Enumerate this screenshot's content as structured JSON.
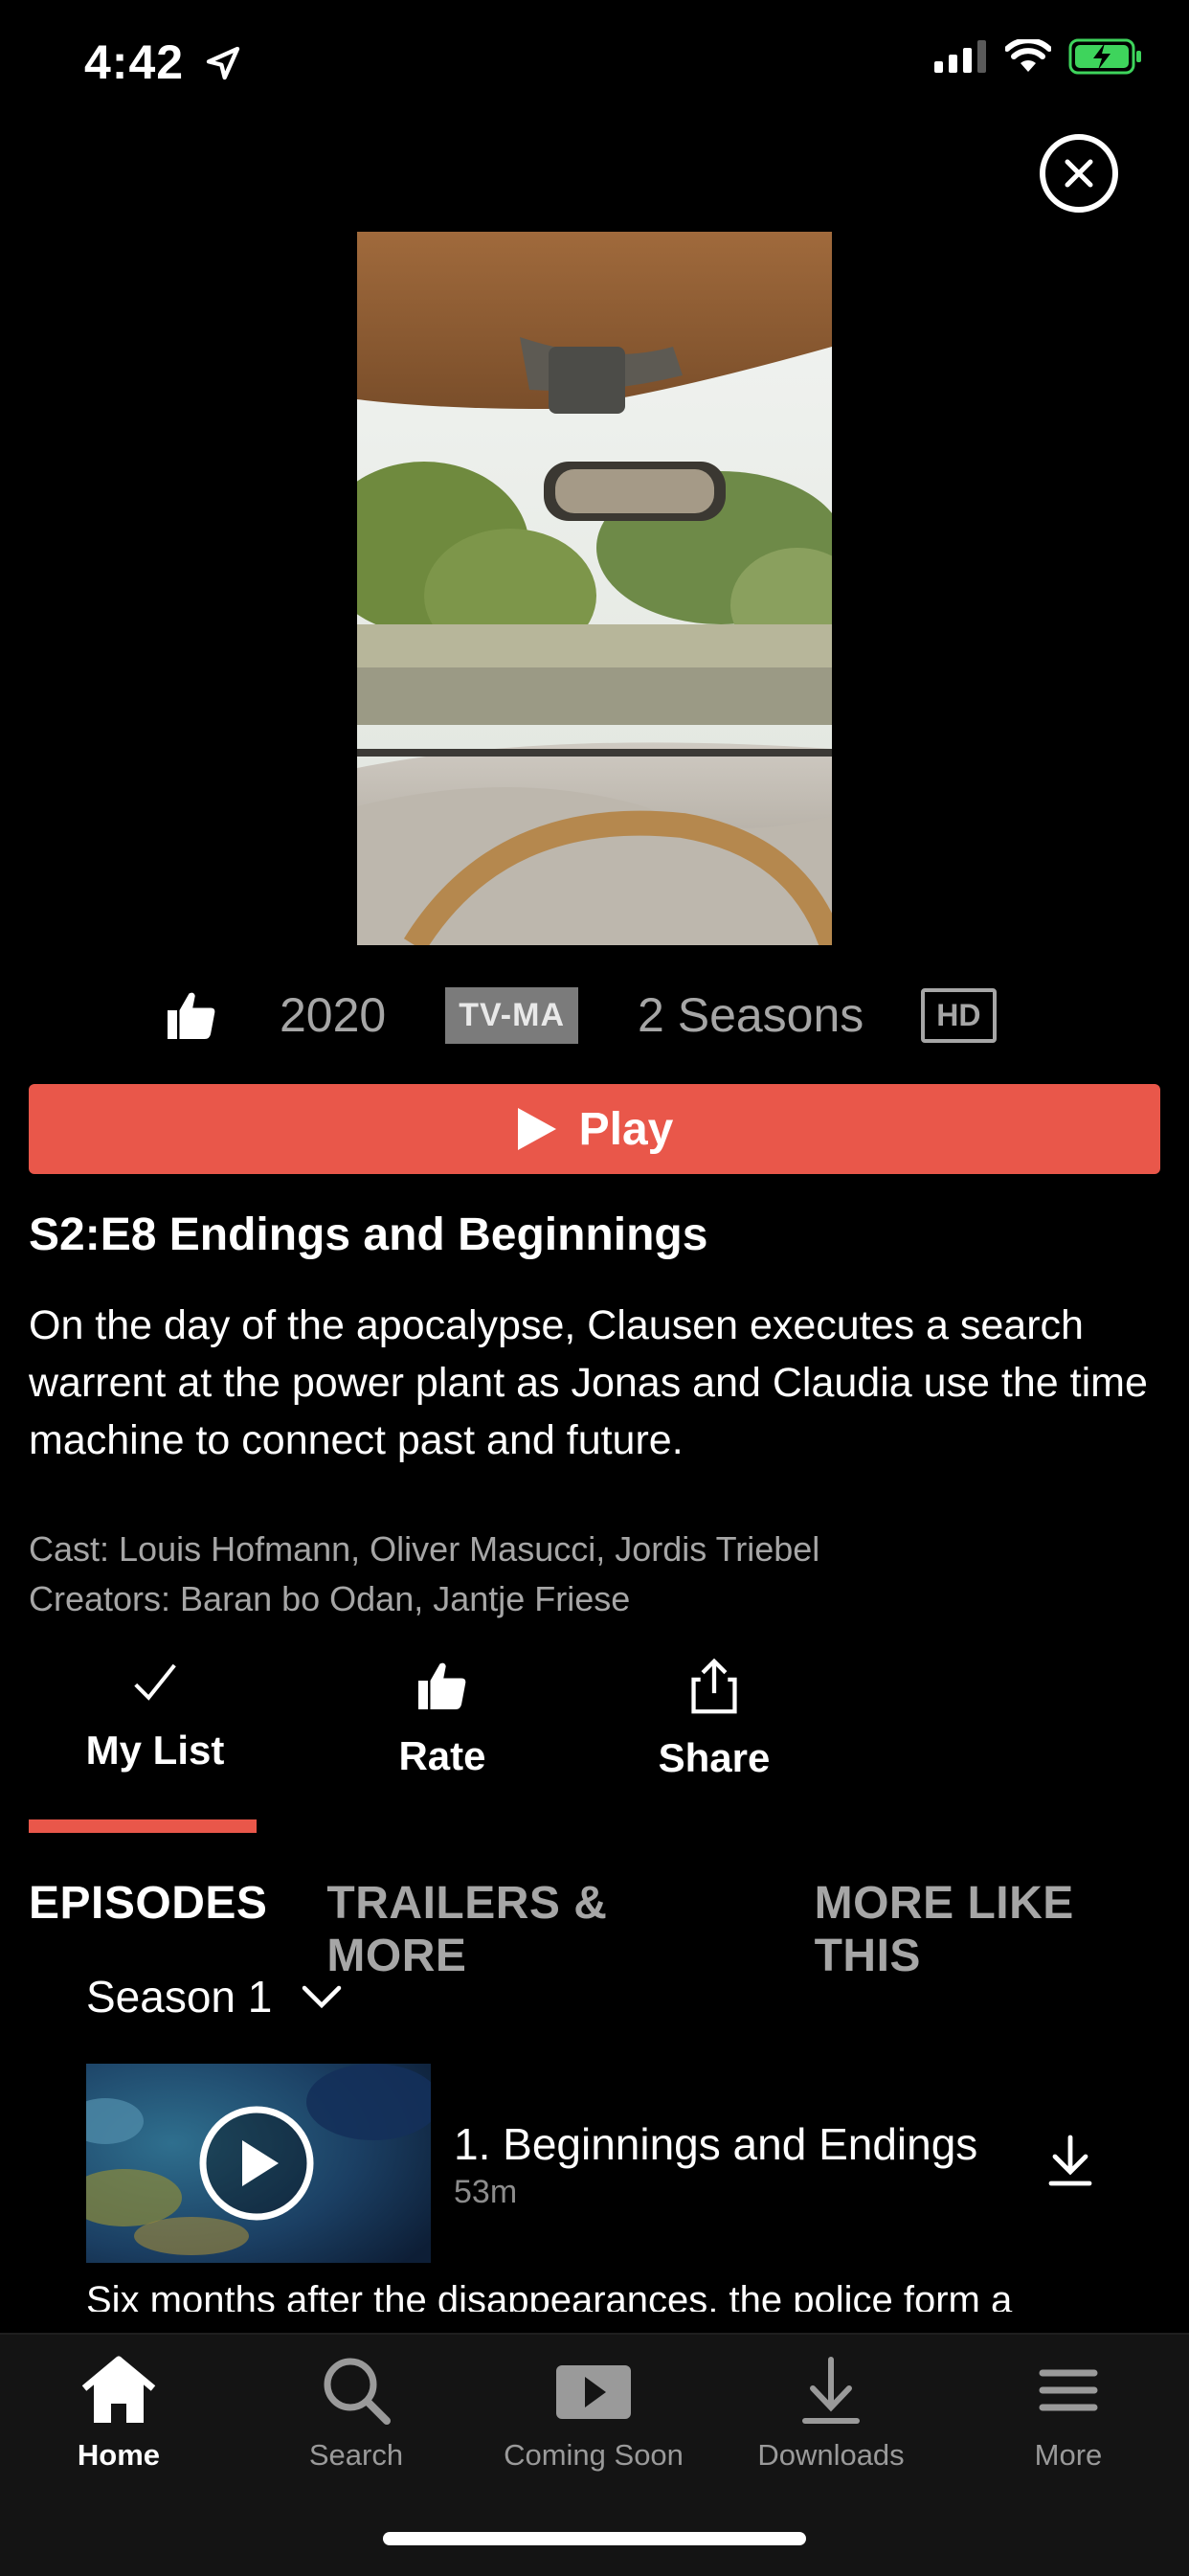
{
  "status_bar": {
    "time": "4:42"
  },
  "meta": {
    "year": "2020",
    "rating": "TV-MA",
    "seasons": "2 Seasons",
    "quality": "HD"
  },
  "play_button": {
    "label": "Play"
  },
  "episode": {
    "title": "S2:E8 Endings and Beginnings",
    "description": "On the day of the apocalypse, Clausen executes a search warrent at the power plant as Jonas and Claudia use the time machine to connect past and future.",
    "cast": "Cast: Louis Hofmann, Oliver Masucci, Jordis Triebel",
    "creators": "Creators: Baran bo Odan, Jantje Friese"
  },
  "actions": [
    {
      "label": "My List",
      "icon": "checkmark-icon"
    },
    {
      "label": "Rate",
      "icon": "thumbs-up-icon"
    },
    {
      "label": "Share",
      "icon": "share-icon"
    }
  ],
  "tabs": [
    "EPISODES",
    "TRAILERS & MORE",
    "MORE LIKE THIS"
  ],
  "season_selector": {
    "label": "Season 1"
  },
  "episode_list": [
    {
      "title": "1. Beginnings and Endings",
      "duration": "53m",
      "description": "Six months after the disappearances, the police form a"
    }
  ],
  "nav": [
    {
      "label": "Home",
      "icon": "home-icon",
      "active": true
    },
    {
      "label": "Search",
      "icon": "search-icon"
    },
    {
      "label": "Coming Soon",
      "icon": "coming-soon-icon"
    },
    {
      "label": "Downloads",
      "icon": "download-icon"
    },
    {
      "label": "More",
      "icon": "menu-icon"
    }
  ],
  "colors": {
    "accent": "#e9574a",
    "background": "#000000",
    "muted_text": "#a6a6a6",
    "tabbar": "#141414"
  }
}
